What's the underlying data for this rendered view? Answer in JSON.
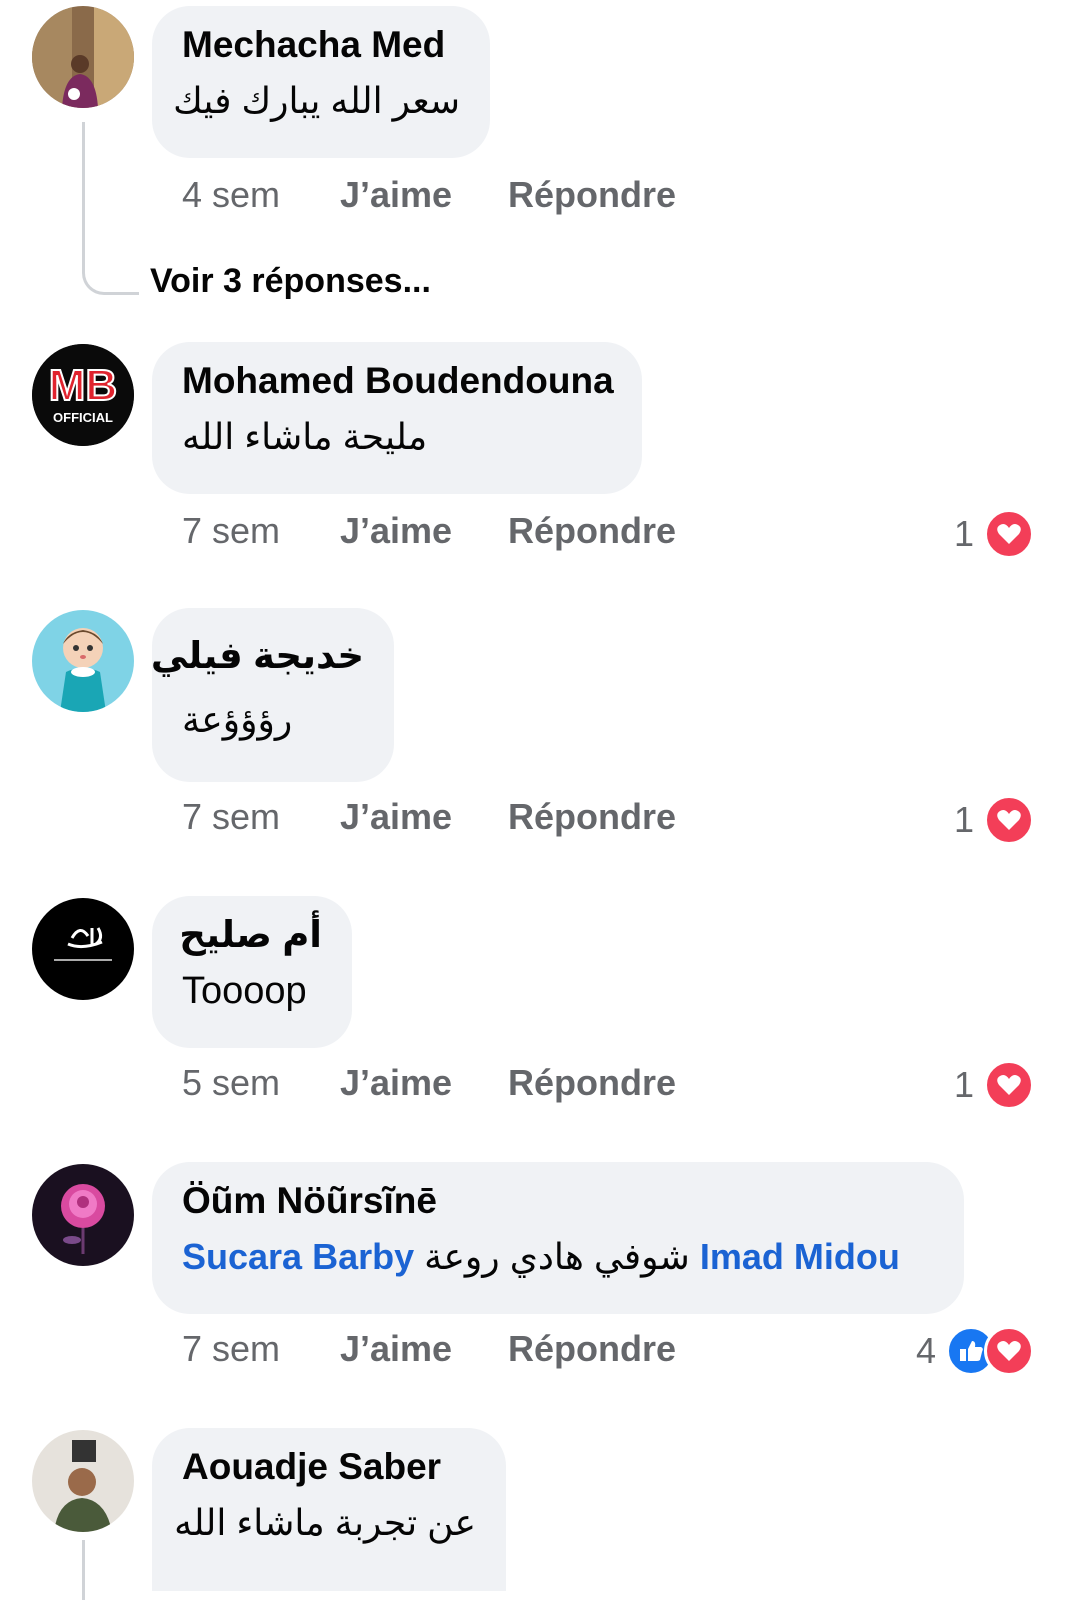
{
  "comments": [
    {
      "author": "Mechacha Med",
      "text": "سعر الله يبارك فيك",
      "time": "4 sem",
      "like_label": "J’aime",
      "reply_label": "Répondre",
      "view_replies": "Voir 3 réponses...",
      "avatar": "user-photo"
    },
    {
      "author": "Mohamed Boudendouna",
      "text": "مليحة ماشاء الله",
      "time": "7 sem",
      "like_label": "J’aime",
      "reply_label": "Répondre",
      "reaction_count": "1",
      "reactions": [
        "love"
      ],
      "avatar": "mb-official-logo",
      "avatar_text": "MB",
      "avatar_subtext": "OFFICIAL"
    },
    {
      "author": "خديجة فيلي",
      "text": "رؤؤؤعة",
      "time": "7 sem",
      "like_label": "J’aime",
      "reply_label": "Répondre",
      "reaction_count": "1",
      "reactions": [
        "love"
      ],
      "avatar": "cartoon-girl"
    },
    {
      "author": "أم صليح",
      "text": "Toooop",
      "time": "5 sem",
      "like_label": "J’aime",
      "reply_label": "Répondre",
      "reaction_count": "1",
      "reactions": [
        "love"
      ],
      "avatar": "calligraphy-black"
    },
    {
      "author": "Öũm Nöũrsĩnē",
      "mention_1": "Sucara Barby",
      "text_middle": "شوفي هادي روعة",
      "mention_2": "Imad Midou",
      "time": "7 sem",
      "like_label": "J’aime",
      "reply_label": "Répondre",
      "reaction_count": "4",
      "reactions": [
        "like",
        "love"
      ],
      "avatar": "pink-rose"
    },
    {
      "author": "Aouadje Saber",
      "text": "عن تجربة ماشاء الله",
      "avatar": "user-photo"
    }
  ],
  "colors": {
    "bubble": "#f0f2f5",
    "mention": "#1b63d3",
    "meta": "#65676b",
    "love": "#f33e58",
    "like": "#1877f2"
  }
}
